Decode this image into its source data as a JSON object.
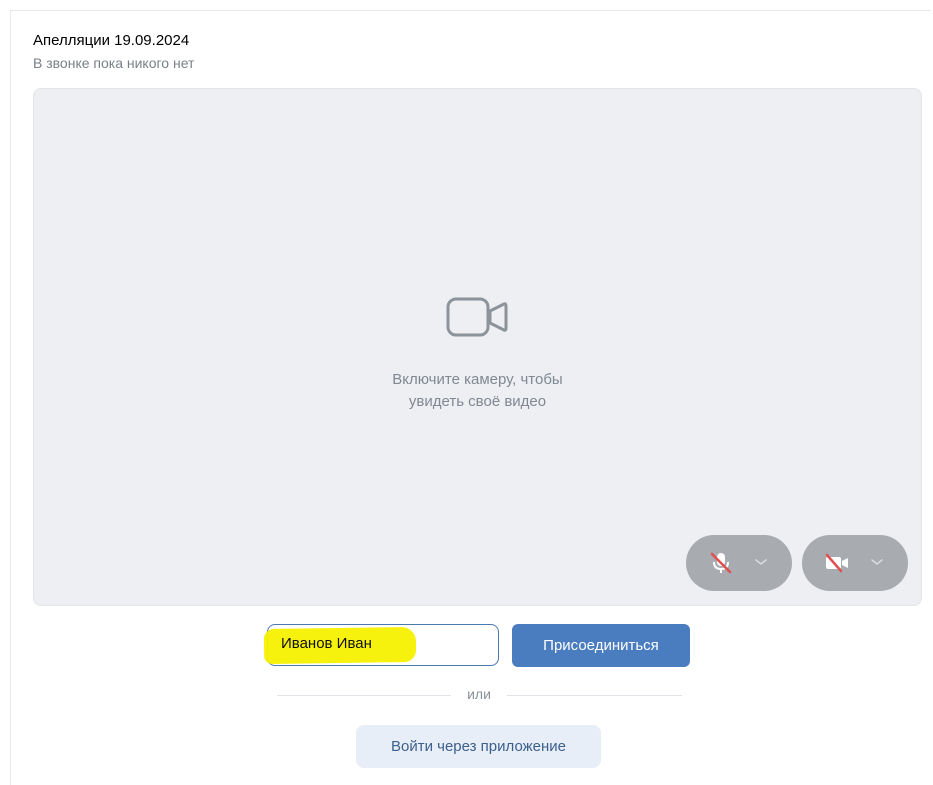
{
  "call": {
    "title": "Апелляции 19.09.2024",
    "status": "В звонке пока никого нет"
  },
  "preview": {
    "icon": "video-camera-icon",
    "hint_line1": "Включите камеру, чтобы",
    "hint_line2": "увидеть своё видео"
  },
  "controls": {
    "mic": {
      "icon": "microphone-off-icon",
      "state": "off"
    },
    "camera": {
      "icon": "camera-off-icon",
      "state": "off"
    }
  },
  "join": {
    "name_value": "Иванов Иван",
    "join_label": "Присоединиться",
    "or_label": "или",
    "app_label": "Войти через приложение"
  },
  "colors": {
    "accent": "#4a7cc0",
    "highlight": "#f7f100",
    "preview_bg": "#edeff2",
    "control_bg": "#a8abb0",
    "muted_red": "#e05050"
  }
}
